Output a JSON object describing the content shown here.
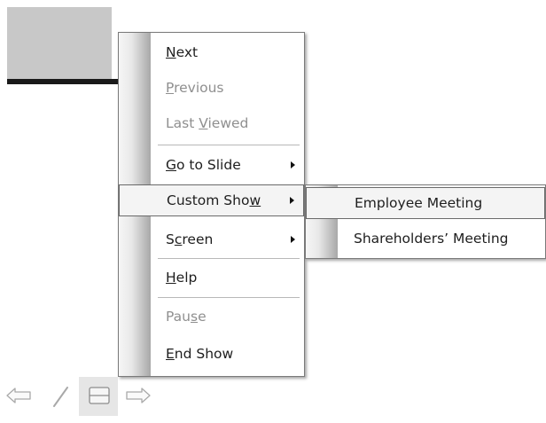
{
  "main_menu": {
    "items": [
      {
        "pre": "",
        "ul": "N",
        "post": "ext"
      },
      {
        "pre": "",
        "ul": "P",
        "post": "revious"
      },
      {
        "pre": "Last ",
        "ul": "V",
        "post": "iewed"
      },
      {
        "pre": "",
        "ul": "G",
        "post": "o to Slide"
      },
      {
        "pre": "Custom Sho",
        "ul": "w",
        "post": ""
      },
      {
        "pre": "S",
        "ul": "c",
        "post": "reen"
      },
      {
        "pre": "",
        "ul": "H",
        "post": "elp"
      },
      {
        "pre": "Pau",
        "ul": "s",
        "post": "e"
      },
      {
        "pre": "",
        "ul": "E",
        "post": "nd Show"
      }
    ]
  },
  "submenu": {
    "items": [
      {
        "label": "Employee Meeting"
      },
      {
        "label": "Shareholders’ Meeting"
      }
    ]
  },
  "toolbar": {
    "buttons": [
      "previous-arrow-icon",
      "pen-icon",
      "menu-icon",
      "next-arrow-icon"
    ]
  },
  "colors": {
    "menu_border": "#7a7a7a",
    "disabled_text": "#8f8f8f",
    "highlight_bg": "#f4f4f4",
    "text": "#1e1e1e"
  }
}
